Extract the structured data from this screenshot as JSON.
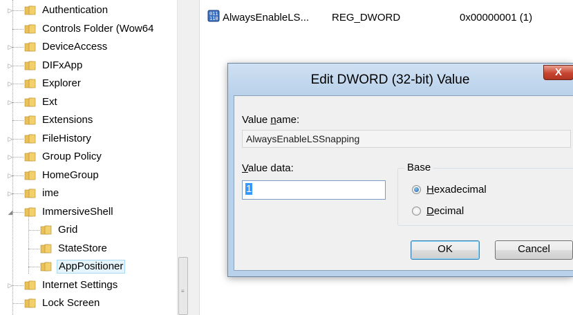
{
  "tree": {
    "items": [
      {
        "label": "Authentication",
        "expander": "▷"
      },
      {
        "label": "Controls Folder (Wow64",
        "expander": ""
      },
      {
        "label": "DeviceAccess",
        "expander": "▷"
      },
      {
        "label": "DIFxApp",
        "expander": "▷"
      },
      {
        "label": "Explorer",
        "expander": "▷"
      },
      {
        "label": "Ext",
        "expander": "▷"
      },
      {
        "label": "Extensions",
        "expander": ""
      },
      {
        "label": "FileHistory",
        "expander": "▷"
      },
      {
        "label": "Group Policy",
        "expander": "▷"
      },
      {
        "label": "HomeGroup",
        "expander": "▷"
      },
      {
        "label": "ime",
        "expander": "▷"
      },
      {
        "label": "ImmersiveShell",
        "expander": "◢"
      },
      {
        "label": "Grid",
        "expander": ""
      },
      {
        "label": "StateStore",
        "expander": ""
      },
      {
        "label": "AppPositioner",
        "expander": ""
      },
      {
        "label": "Internet Settings",
        "expander": "▷"
      },
      {
        "label": "Lock Screen",
        "expander": ""
      }
    ],
    "grip": "≡"
  },
  "values_pane": {
    "row": {
      "name": "AlwaysEnableLS...",
      "type": "REG_DWORD",
      "data": "0x00000001 (1)"
    }
  },
  "dialog": {
    "title": "Edit DWORD (32-bit) Value",
    "close_glyph": "X",
    "value_name_label_pre": "Value ",
    "value_name_label_ul": "n",
    "value_name_label_post": "ame:",
    "value_name": "AlwaysEnableLSSnapping",
    "value_data_label_ul": "V",
    "value_data_label_post": "alue data:",
    "value_data": "1",
    "base_label": "Base",
    "hex_ul": "H",
    "hex_post": "exadecimal",
    "dec_ul": "D",
    "dec_post": "ecimal",
    "selected_base": "Hexadecimal",
    "ok_label": "OK",
    "cancel_label": "Cancel"
  },
  "colors": {
    "dialog_frame": "#b9d1ea",
    "close_button": "#c7442f",
    "selection": "#3399ff"
  }
}
